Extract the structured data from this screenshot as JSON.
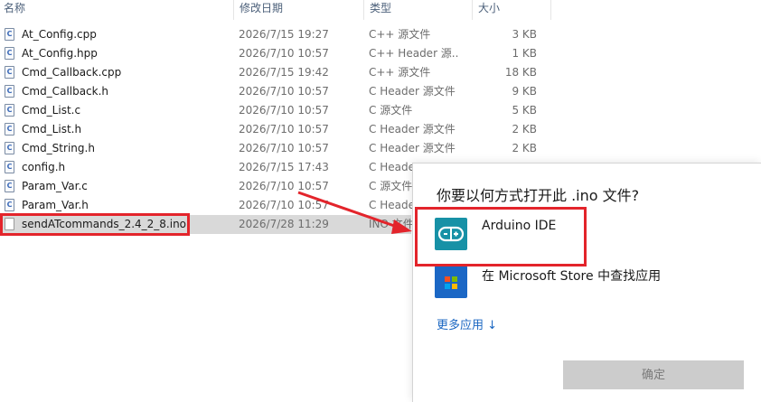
{
  "columns": {
    "name": "名称",
    "date": "修改日期",
    "type": "类型",
    "size": "大小"
  },
  "files": [
    {
      "name": "At_Config.cpp",
      "date": "2026/7/15 19:27",
      "type": "C++ 源文件",
      "size": "3 KB",
      "icon": "c-source-icon"
    },
    {
      "name": "At_Config.hpp",
      "date": "2026/7/10 10:57",
      "type": "C++ Header 源...",
      "size": "1 KB",
      "icon": "c-source-icon"
    },
    {
      "name": "Cmd_Callback.cpp",
      "date": "2026/7/15 19:42",
      "type": "C++ 源文件",
      "size": "18 KB",
      "icon": "c-source-icon"
    },
    {
      "name": "Cmd_Callback.h",
      "date": "2026/7/10 10:57",
      "type": "C Header 源文件",
      "size": "9 KB",
      "icon": "c-source-icon"
    },
    {
      "name": "Cmd_List.c",
      "date": "2026/7/10 10:57",
      "type": "C 源文件",
      "size": "5 KB",
      "icon": "c-source-icon"
    },
    {
      "name": "Cmd_List.h",
      "date": "2026/7/10 10:57",
      "type": "C Header 源文件",
      "size": "2 KB",
      "icon": "c-source-icon"
    },
    {
      "name": "Cmd_String.h",
      "date": "2026/7/10 10:57",
      "type": "C Header 源文件",
      "size": "2 KB",
      "icon": "c-source-icon"
    },
    {
      "name": "config.h",
      "date": "2026/7/15 17:43",
      "type": "C Header",
      "size": "",
      "icon": "c-source-icon"
    },
    {
      "name": "Param_Var.c",
      "date": "2026/7/10 10:57",
      "type": "C 源文件",
      "size": "",
      "icon": "c-source-icon"
    },
    {
      "name": "Param_Var.h",
      "date": "2026/7/10 10:57",
      "type": "C Header",
      "size": "",
      "icon": "c-source-icon"
    },
    {
      "name": "sendATcommands_2.4_2_8.ino",
      "date": "2026/7/28 11:29",
      "type": "INO 文件",
      "size": "",
      "icon": "blank-file-icon"
    }
  ],
  "dialog": {
    "title": "你要以何方式打开此 .ino 文件?",
    "apps": [
      {
        "label": "Arduino IDE",
        "icon": "arduino-icon"
      },
      {
        "label": "在 Microsoft Store 中查找应用",
        "icon": "microsoft-store-icon"
      }
    ],
    "more_apps": "更多应用 ↓",
    "ok_label": "确定"
  },
  "colors": {
    "annotation_red": "#e3242b",
    "arduino_teal": "#1791a6",
    "store_blue": "#1b67c5",
    "link_blue": "#1a66c2",
    "selection_gray": "#d9d9d9"
  }
}
